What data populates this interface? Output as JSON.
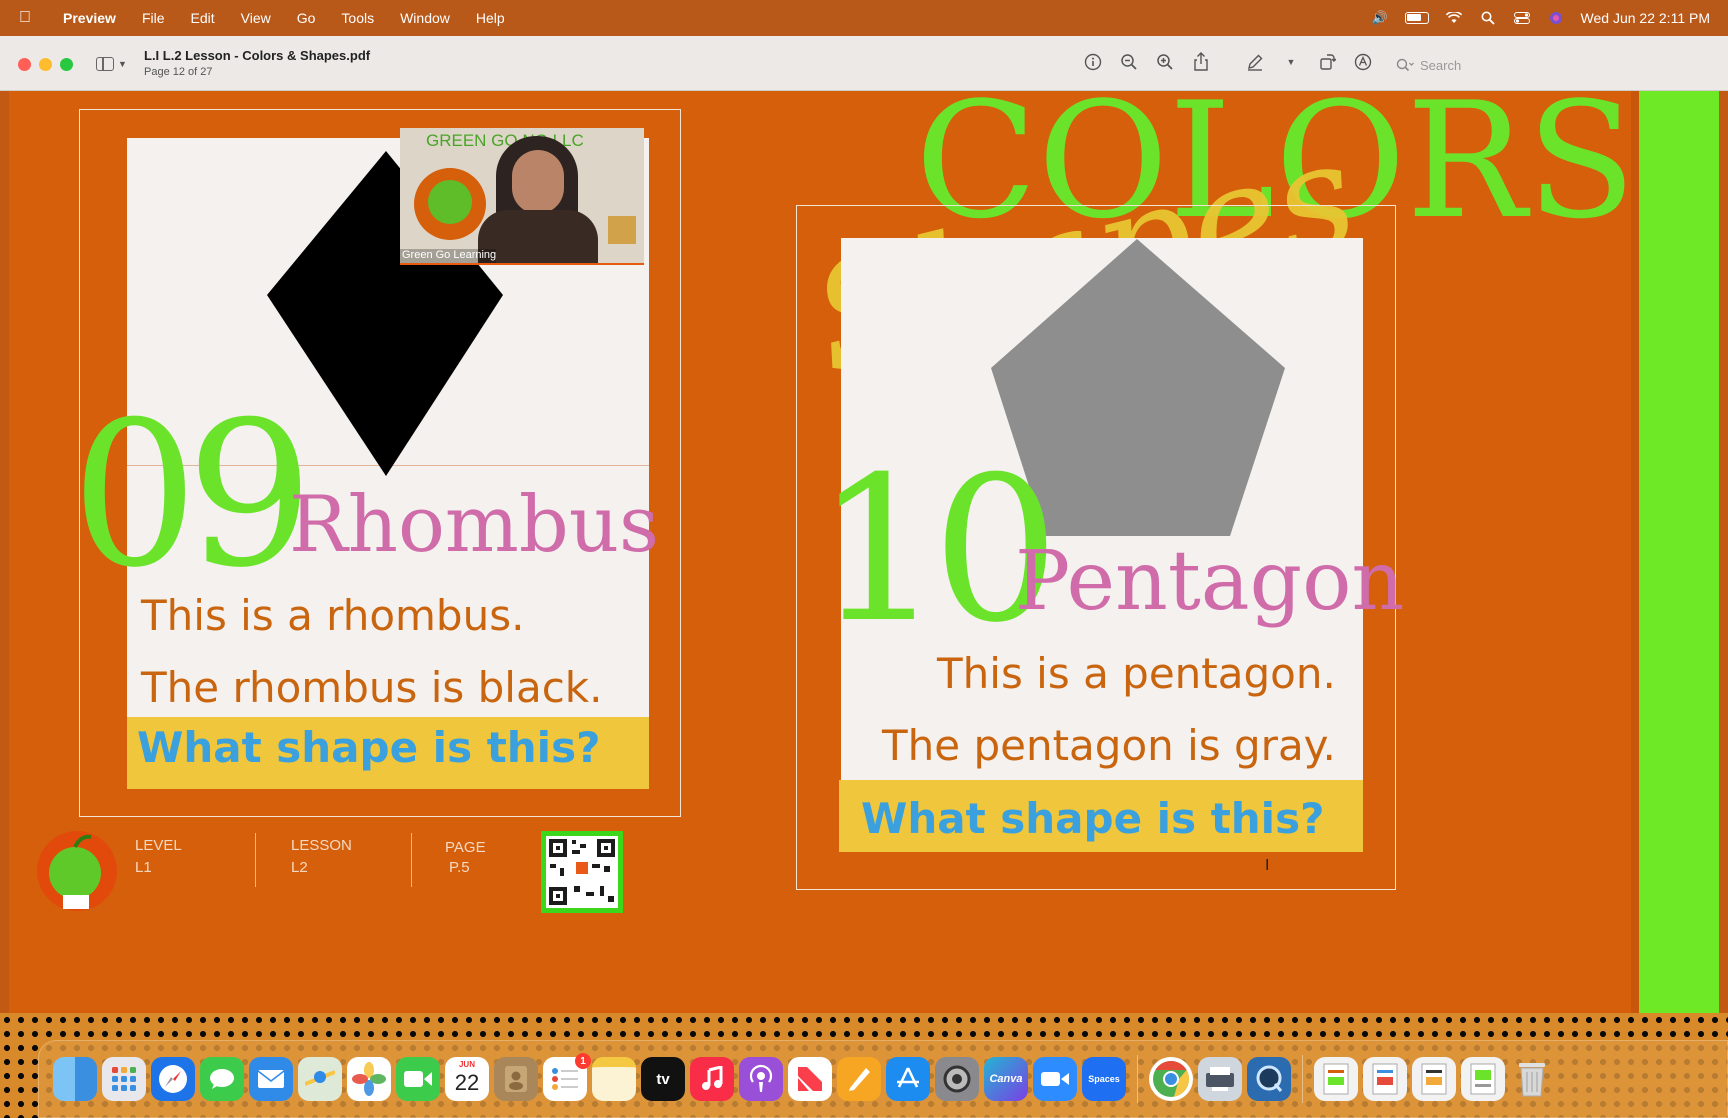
{
  "menubar": {
    "app_name": "Preview",
    "menus": [
      "File",
      "Edit",
      "View",
      "Go",
      "Tools",
      "Window",
      "Help"
    ],
    "clock": "Wed Jun 22  2:11 PM"
  },
  "window": {
    "title": "L.I L.2 Lesson - Colors & Shapes.pdf",
    "subtitle": "Page 12 of 27",
    "search_placeholder": "Search"
  },
  "page": {
    "header_title": "COLORS",
    "header_script": "Shapes",
    "card1": {
      "number": "09",
      "name": "Rhombus",
      "line1": "This is a rhombus.",
      "line2": "The rhombus is black.",
      "question": "What shape is this?",
      "shape_color": "#000000"
    },
    "card2": {
      "number": "10",
      "name": "Pentagon",
      "line1": "This is a pentagon.",
      "line2": "The pentagon is gray.",
      "question": "What shape is this?",
      "shape_color": "#8e8e8e"
    },
    "footer": {
      "level_label": "LEVEL",
      "level_value": "L1",
      "lesson_label": "LESSON",
      "lesson_value": "L2",
      "page_label": "PAGE",
      "page_value": "P.5"
    }
  },
  "video": {
    "banner_text": "GREEN GO      NG LLC",
    "name": "Green Go Learning"
  },
  "dock": {
    "calendar_month": "JUN",
    "calendar_day": "22",
    "reminders_badge": "1",
    "tv_label": "tv",
    "canva_label": "Canva",
    "spaces_label": "Spaces"
  },
  "colors": {
    "orange_bg": "#d55f0a",
    "green_accent": "#6be32a",
    "pink_title": "#cf6ca9",
    "question_blue": "#3aa0de",
    "question_yellow": "#efc63c"
  }
}
